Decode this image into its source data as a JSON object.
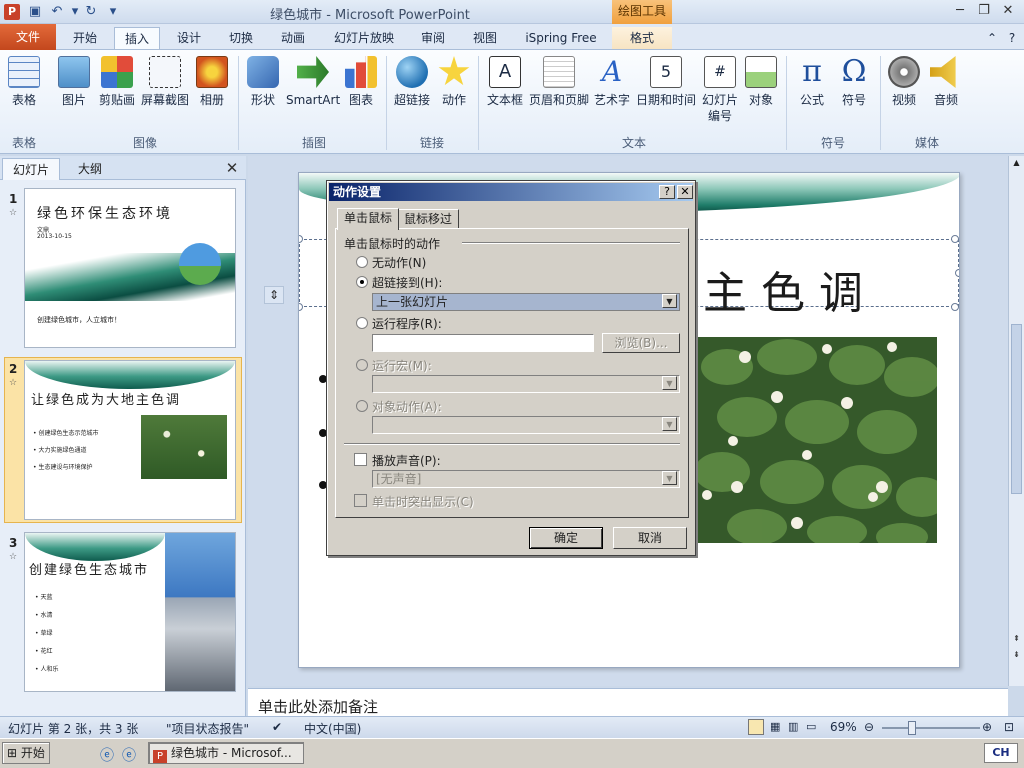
{
  "window": {
    "title": "绿色城市 - Microsoft PowerPoint",
    "context_tool": "绘图工具",
    "app_icon": "P"
  },
  "tabs": [
    "文件",
    "开始",
    "插入",
    "设计",
    "切换",
    "动画",
    "幻灯片放映",
    "审阅",
    "视图",
    "iSpring Free",
    "格式"
  ],
  "ribbon": {
    "buttons": [
      "表格",
      "图片",
      "剪贴画",
      "屏幕截图",
      "相册",
      "形状",
      "SmartArt",
      "图表",
      "超链接",
      "动作",
      "文本框",
      "页眉和页脚",
      "艺术字",
      "日期和时间",
      "幻灯片",
      "编号",
      "对象",
      "公式",
      "符号",
      "视频",
      "音频"
    ],
    "groups": [
      "表格",
      "图像",
      "插图",
      "链接",
      "文本",
      "符号",
      "媒体"
    ]
  },
  "left_pane": {
    "tabs": [
      "幻灯片",
      "大纲"
    ],
    "slides": [
      {
        "num": "1",
        "title": "绿色环保生态环境",
        "author": "文鼎",
        "date": "2013-10-15",
        "footer": "创建绿色城市，人立城市！"
      },
      {
        "num": "2",
        "title": "让绿色成为大地主色调",
        "bullets": [
          "创建绿色生态示范城市",
          "大力实施绿色通道",
          "生态建设与环境保护"
        ]
      },
      {
        "num": "3",
        "title": "创建绿色生态城市",
        "bullets": [
          "天蓝",
          "水清",
          "草绿",
          "花红",
          "人和乐"
        ]
      }
    ]
  },
  "slide": {
    "title_visible": "主色调"
  },
  "notes": {
    "placeholder": "单击此处添加备注"
  },
  "status": {
    "slide_info": "幻灯片 第 2 张，共 3 张",
    "theme": "\"项目状态报告\"",
    "language": "中文(中国)",
    "zoom": "69%"
  },
  "taskbar": {
    "start": "开始",
    "task": "绿色城市 - Microsof...",
    "tray": "CH"
  },
  "dialog": {
    "title": "动作设置",
    "help": "?",
    "close": "✕",
    "tabs": [
      "单击鼠标",
      "鼠标移过"
    ],
    "section": "单击鼠标时的动作",
    "opt_none": "无动作(N)",
    "opt_hyperlink": "超链接到(H):",
    "hyperlink_value": "上一张幻灯片",
    "opt_program": "运行程序(R):",
    "browse": "浏览(B)...",
    "opt_macro": "运行宏(M):",
    "opt_object": "对象动作(A):",
    "play_sound": "播放声音(P):",
    "sound_value": "[无声音]",
    "highlight": "单击时突出显示(C)",
    "ok": "确定",
    "cancel": "取消"
  },
  "colors": {
    "accent_orange": "#c3471d",
    "context_tab": "#f0a03e",
    "dialog_titlebar": "#0a246a",
    "selected_slide": "#fbe3a6"
  }
}
